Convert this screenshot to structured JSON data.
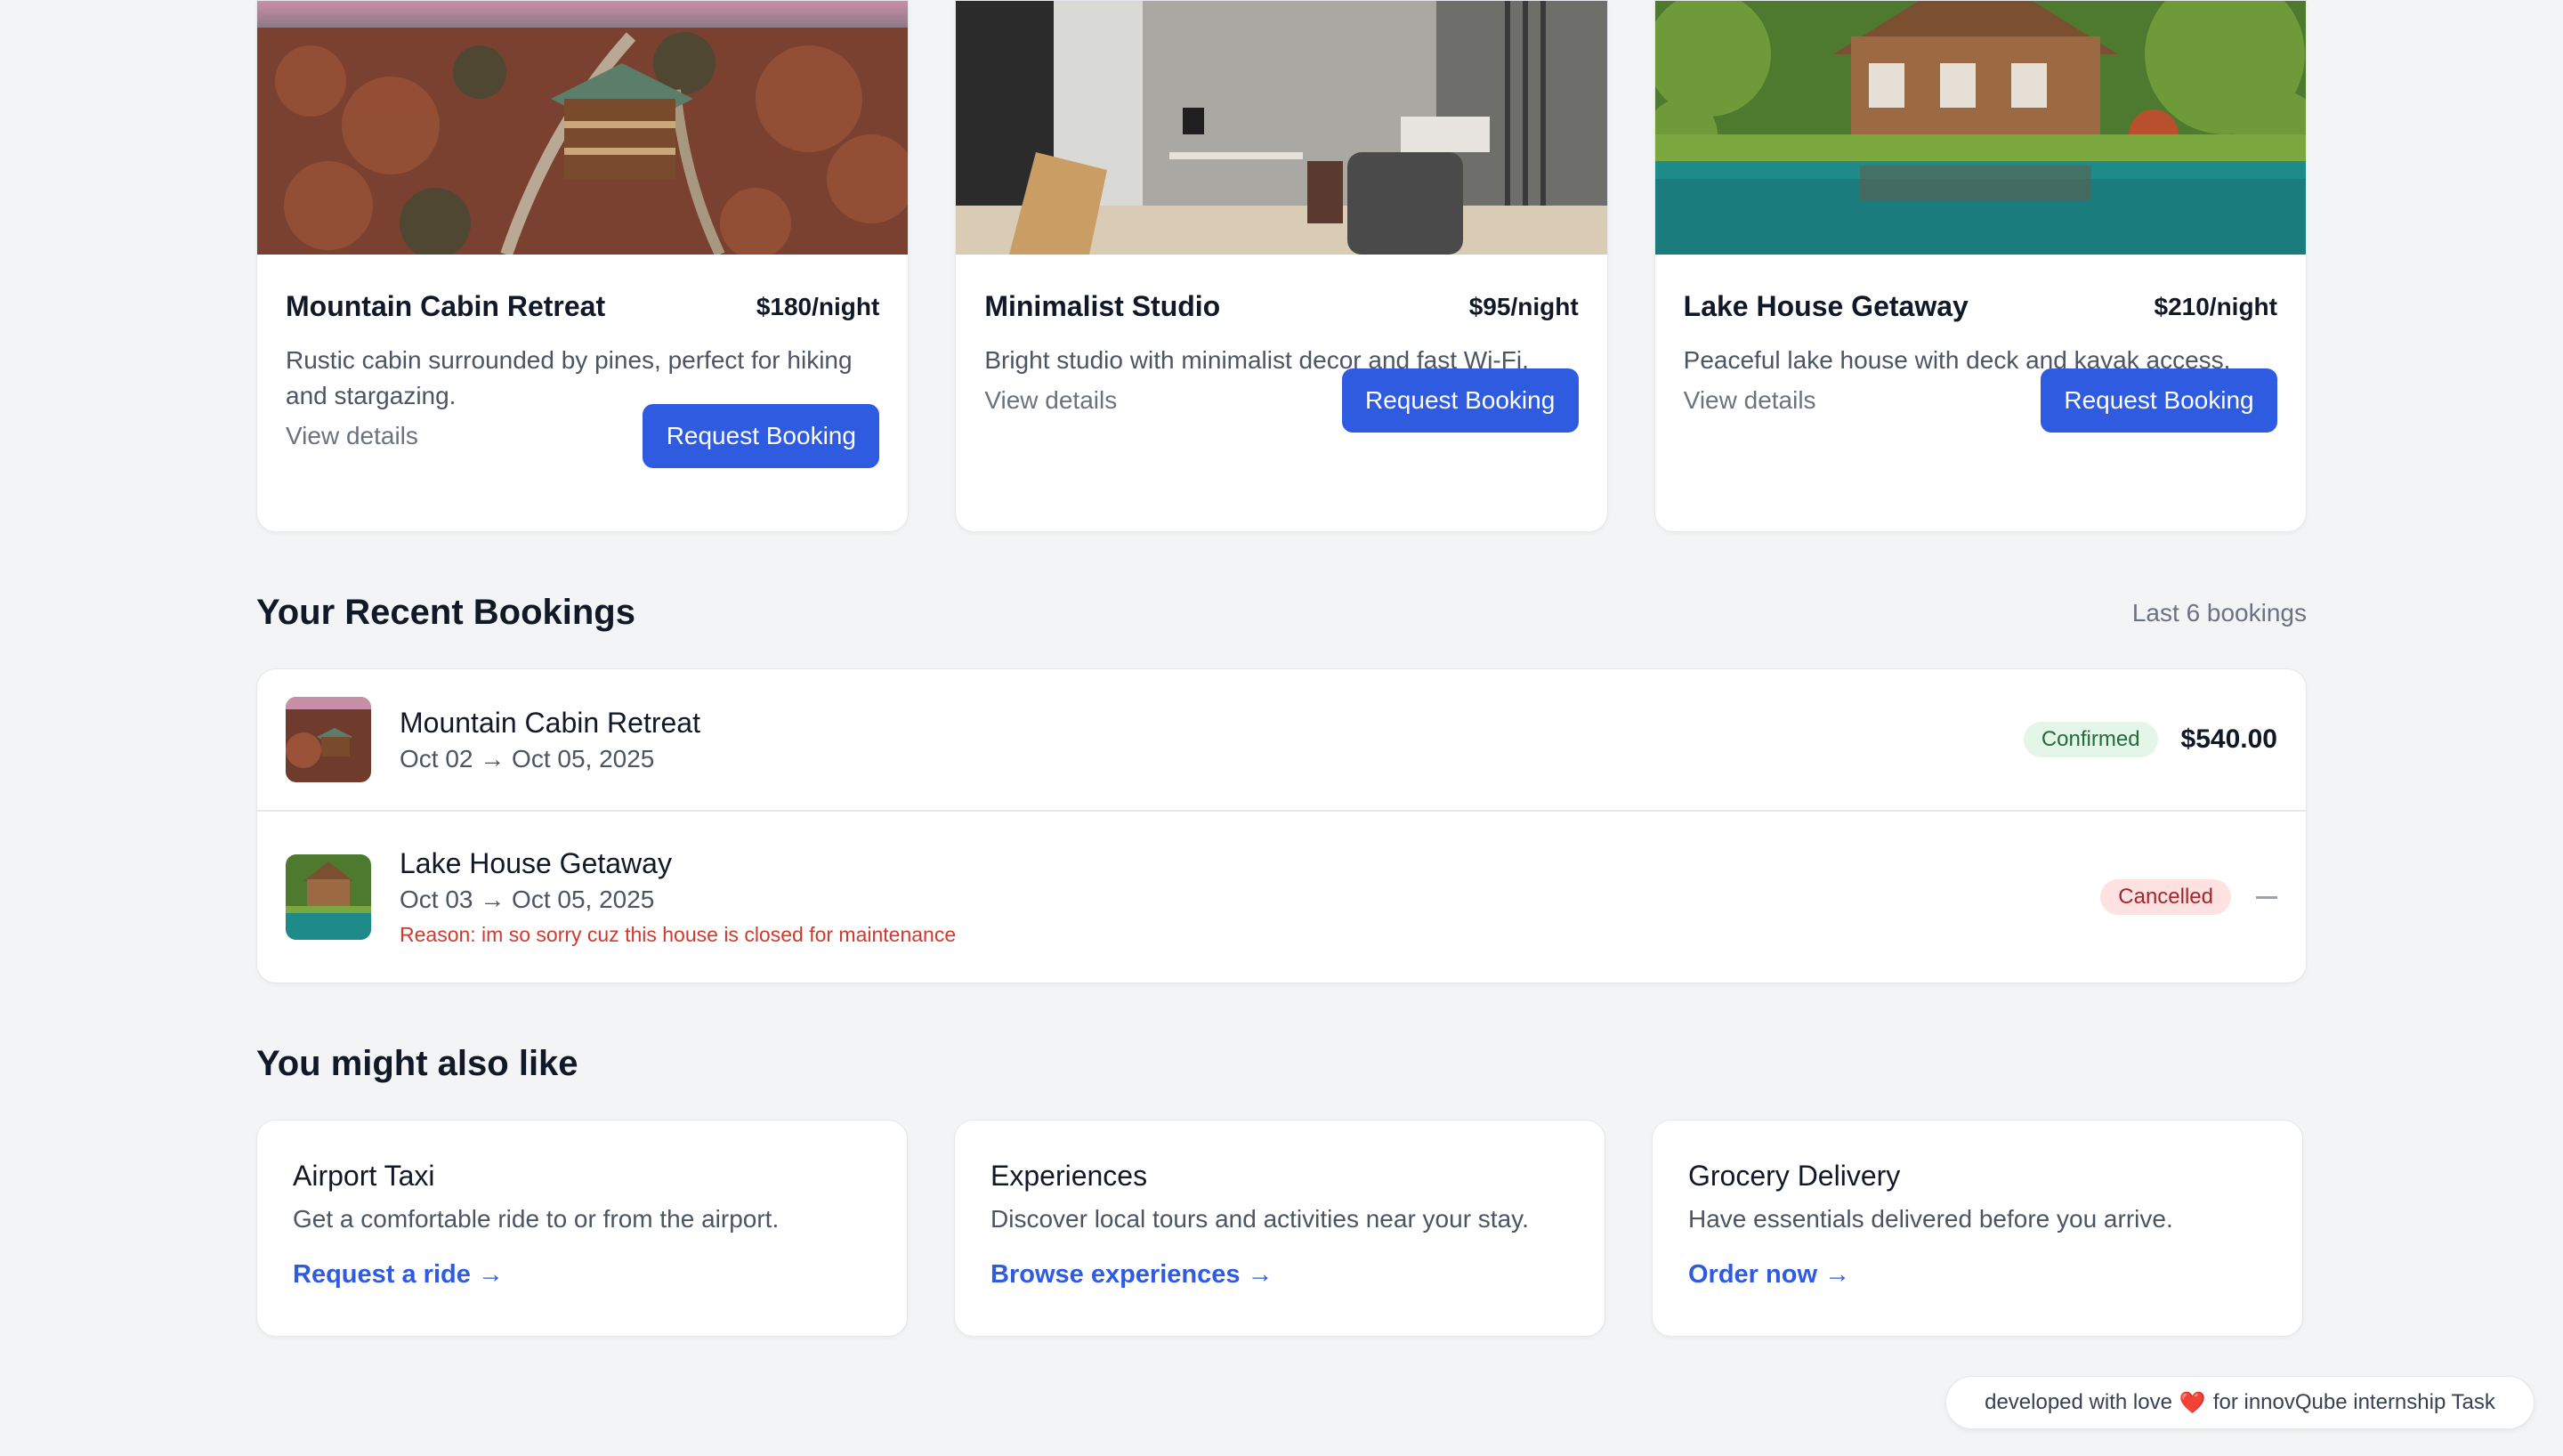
{
  "listings": [
    {
      "title": "Mountain Cabin Retreat",
      "price": "$180/night",
      "description": "Rustic cabin surrounded by pines, perfect for hiking and stargazing.",
      "view_label": "View details",
      "button_label": "Request Booking"
    },
    {
      "title": "Minimalist Studio",
      "price": "$95/night",
      "description": "Bright studio with minimalist decor and fast Wi-Fi.",
      "view_label": "View details",
      "button_label": "Request Booking"
    },
    {
      "title": "Lake House Getaway",
      "price": "$210/night",
      "description": "Peaceful lake house with deck and kayak access.",
      "view_label": "View details",
      "button_label": "Request Booking"
    }
  ],
  "bookings_section": {
    "title": "Your Recent Bookings",
    "meta": "Last 6 bookings",
    "items": [
      {
        "name": "Mountain Cabin Retreat",
        "dates": "Oct 02 → Oct 05, 2025",
        "status": "Confirmed",
        "amount": "$540.00"
      },
      {
        "name": "Lake House Getaway",
        "dates": "Oct 03 → Oct 05, 2025",
        "status": "Cancelled",
        "reason": "Reason: im so sorry cuz this house is closed for maintenance"
      }
    ]
  },
  "recommendations": {
    "title": "You might also like",
    "items": [
      {
        "title": "Airport Taxi",
        "description": "Get a comfortable ride to or from the airport.",
        "link": "Request a ride →"
      },
      {
        "title": "Experiences",
        "description": "Discover local tours and activities near your stay.",
        "link": "Browse experiences →"
      },
      {
        "title": "Grocery Delivery",
        "description": "Have essentials delivered before you arrive.",
        "link": "Order now →"
      }
    ]
  },
  "footer": {
    "prefix": "developed with love",
    "heart": "❤️",
    "suffix": "for innovQube internship Task"
  },
  "colors": {
    "primary": "#2f5be0",
    "background": "#f3f4f6",
    "confirmed_bg": "#e3f6e8",
    "cancelled_bg": "#fde2e1",
    "reason_text": "#d03a2f"
  }
}
